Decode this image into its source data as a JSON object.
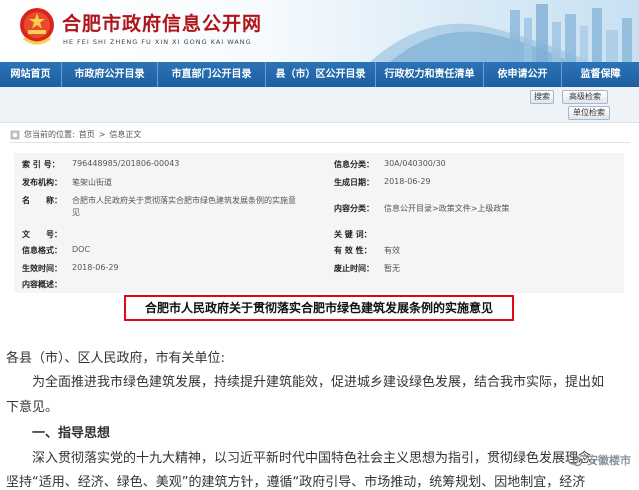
{
  "header": {
    "title": "合肥市政府信息公开网",
    "subtitle": "HE FEI SHI ZHENG FU XIN XI GONG KAI WANG"
  },
  "nav": {
    "items": [
      {
        "label": "网站首页"
      },
      {
        "label": "市政府公开目录"
      },
      {
        "label": "市直部门公开目录"
      },
      {
        "label": "县（市）区公开目录"
      },
      {
        "label": "行政权力和责任清单"
      },
      {
        "label": "依申请公开"
      },
      {
        "label": "监督保障"
      }
    ]
  },
  "search": {
    "search_label": "搜索",
    "advanced_label": "高级检索",
    "unit_label": "单位检索"
  },
  "breadcrumb": {
    "prefix": "您当前的位置:",
    "home": "首页",
    "separator": ">",
    "current": "信息正文"
  },
  "meta": {
    "index_no_key": "索 引 号：",
    "index_no": "796448985/201806-00043",
    "category_key": "信息分类：",
    "category": "30A/040300/30",
    "publisher_key": "发布机构：",
    "publisher": "笔架山街道",
    "date_key": "生成日期：",
    "date": "2018-06-29",
    "name_key": "名　　称：",
    "name_line1": "合肥市人民政府关于贯彻落实合肥市绿色建筑发展条例的实施意",
    "name_line2": "见",
    "content_cat_key": "内容分类：",
    "content_cat": "信息公开目录>政策文件>上级政策",
    "doc_no_key": "文　　号：",
    "doc_no": "",
    "keyword_key": "关 键 词：",
    "keyword": "",
    "format_key": "信息格式：",
    "format": "DOC",
    "validity_key": "有 效 性：",
    "validity": "有效",
    "effective_key": "生效时间：",
    "effective": "2018-06-29",
    "expiry_key": "废止时间：",
    "expiry": "暂无",
    "summary_key": "内容概述："
  },
  "document": {
    "title": "合肥市人民政府关于贯彻落实合肥市绿色建筑发展条例的实施意见",
    "line1": "各县（市）、区人民政府，市有关单位:",
    "line2": "　　为全面推进我市绿色建筑发展，持续提升建筑能效，促进城乡建设绿色发展，结合我市实际，提出如",
    "line3": "下意见。",
    "line4": "　　一、指导思想",
    "line5": "　　深入贯彻落实党的十九大精神，以习近平新时代中国特色社会主义思想为指引，贯彻绿色发展理念，",
    "line6": "坚持“适用、经济、绿色、美观”的建筑方针，遵循“政府引导、市场推动，统筹规划、因地制宜，经济"
  },
  "watermark": {
    "text": "安徽楼市"
  },
  "colors": {
    "brand_red": "#b0141a",
    "nav_blue": "#1d5e9f",
    "title_border": "#e30613"
  }
}
